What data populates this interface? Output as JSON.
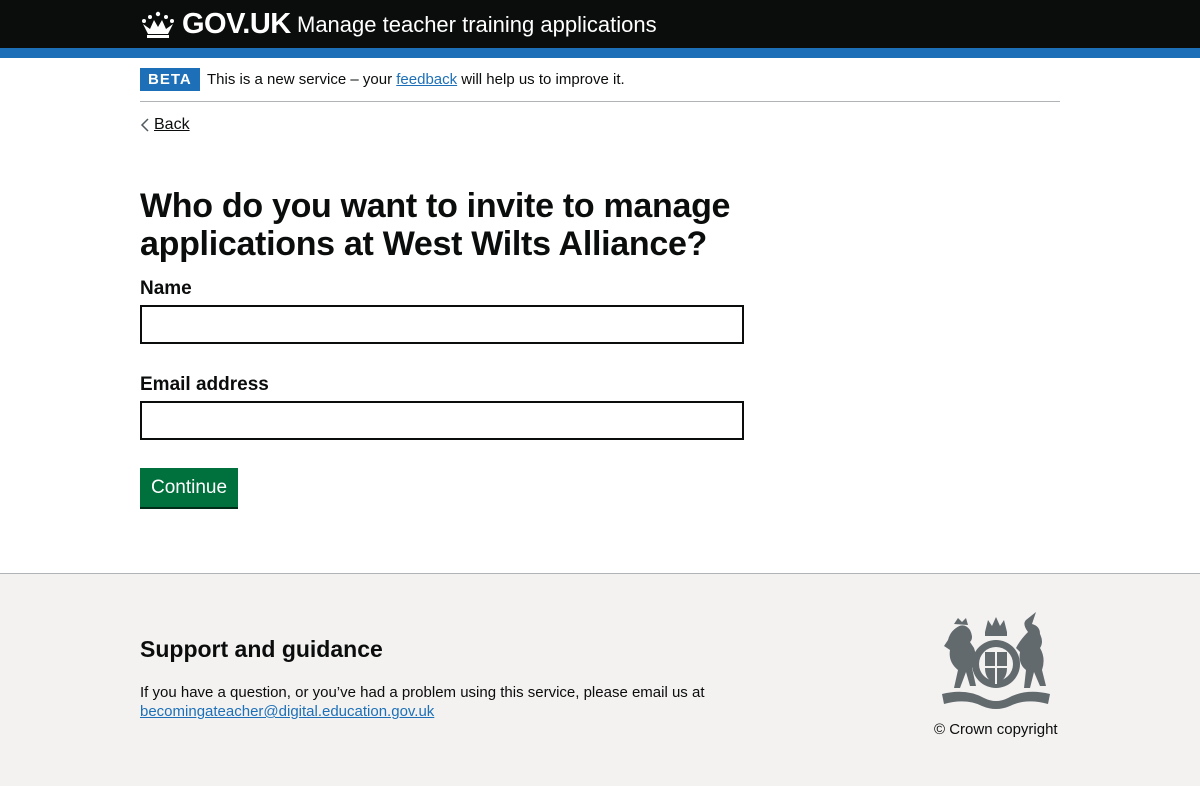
{
  "header": {
    "logo_icon": "crown-icon",
    "logo_text": "GOV.UK",
    "service_name": "Manage teacher training applications"
  },
  "phase_banner": {
    "tag": "BETA",
    "text_before": "This is a new service – your ",
    "link_text": "feedback",
    "text_after": " will help us to improve it."
  },
  "back_link": {
    "icon": "chevron-left-icon",
    "label": "Back"
  },
  "main": {
    "title": "Who do you want to invite to manage applications at West Wilts Alliance?",
    "form": {
      "name_label": "Name",
      "name_value": "",
      "email_label": "Email address",
      "email_value": "",
      "continue_label": "Continue"
    }
  },
  "footer": {
    "heading": "Support and guidance",
    "text": "If you have a question, or you’ve had a problem using this service, please email us at",
    "email": "becomingateacher@digital.education.gov.uk",
    "crest_icon": "royal-coat-of-arms-icon",
    "copyright": "© Crown copyright"
  },
  "colors": {
    "header_bg": "#0b0c0c",
    "header_stripe": "#1d70b8",
    "link": "#1d70b8",
    "button": "#00703c",
    "footer_bg": "#f3f2f1"
  }
}
